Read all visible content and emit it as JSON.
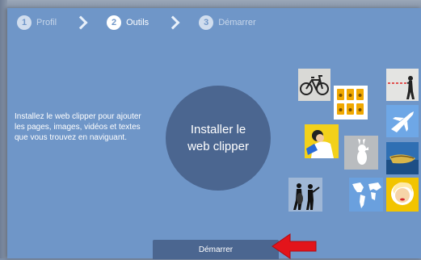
{
  "steps": [
    {
      "number": "1",
      "label": "Profil",
      "state": "done"
    },
    {
      "number": "2",
      "label": "Outils",
      "state": "active"
    },
    {
      "number": "3",
      "label": "Démarrer",
      "state": "upcoming"
    }
  ],
  "description": "Installez le web clipper pour ajouter les pages, images, vidéos et textes que vous trouvez en naviguant.",
  "install_circle": {
    "line1": "Installer le",
    "line2": "web clipper"
  },
  "start_button": {
    "label": "Démarrer"
  },
  "tiles": [
    "bicycle-icon",
    "folders-icon",
    "target-shooter-icon",
    "airplane-icon",
    "person-yellow-icon",
    "rabbit-icon",
    "boat-icon",
    "musicians-icon",
    "world-map-icon",
    "portrait-icon"
  ],
  "colors": {
    "panel": "#6f96c8",
    "accent_dark": "#4b6690",
    "arrow": "#e3141b"
  }
}
